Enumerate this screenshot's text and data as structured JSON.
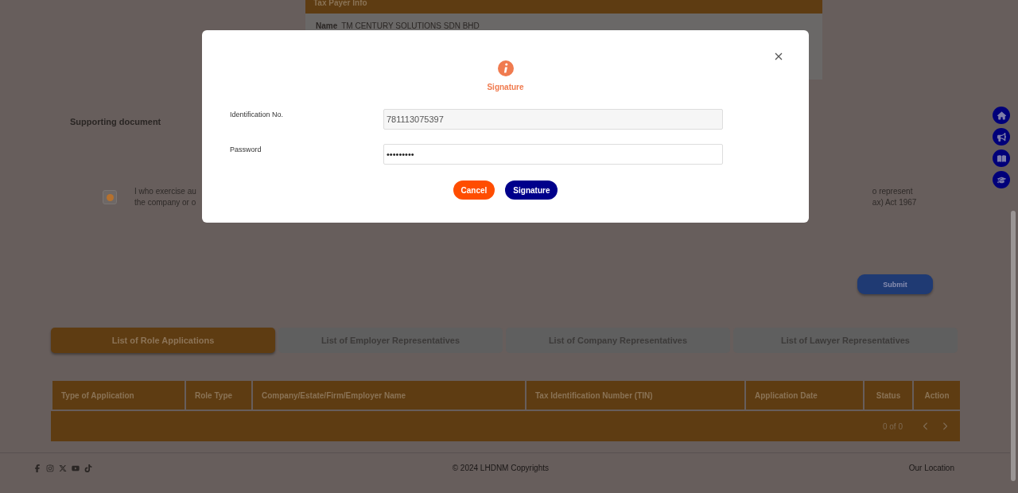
{
  "taxpayer_card": {
    "header": "Tax Payer Info",
    "name_label": "Name",
    "name_value": "TM CENTURY SOLUTIONS SDN BHD"
  },
  "supporting_document": {
    "label": "Supporting document"
  },
  "declaration": {
    "checked": true,
    "left_lines": [
      "I who exercise au",
      "the company or o"
    ],
    "right_lines": [
      "o represent",
      "ax) Act 1967"
    ]
  },
  "submit_button": "Submit",
  "tabs": [
    {
      "label": "List of Role Applications",
      "selected": true
    },
    {
      "label": "List of Employer Representatives",
      "selected": false
    },
    {
      "label": "List of Company Representatives",
      "selected": false
    },
    {
      "label": "List of Lawyer Representatives",
      "selected": false
    }
  ],
  "table": {
    "columns": [
      "Type of Application",
      "Role Type",
      "Company/Estate/Firm/Employer Name",
      "Tax Identification Number (TIN)",
      "Application Date",
      "Status",
      "Action"
    ],
    "pagination": "0 of 0"
  },
  "footer": {
    "copyright": "© 2024 LHDNM Copyrights",
    "location_link": "Our Location"
  },
  "modal": {
    "title": "Signature",
    "fields": [
      {
        "label": "Identification No.",
        "value": "781113075397",
        "readonly": true
      },
      {
        "label": "Password",
        "value": "•••••••••",
        "readonly": false
      }
    ],
    "buttons": [
      {
        "label": "Cancel",
        "kind": "cancel"
      },
      {
        "label": "Signature",
        "kind": "confirm"
      }
    ]
  }
}
